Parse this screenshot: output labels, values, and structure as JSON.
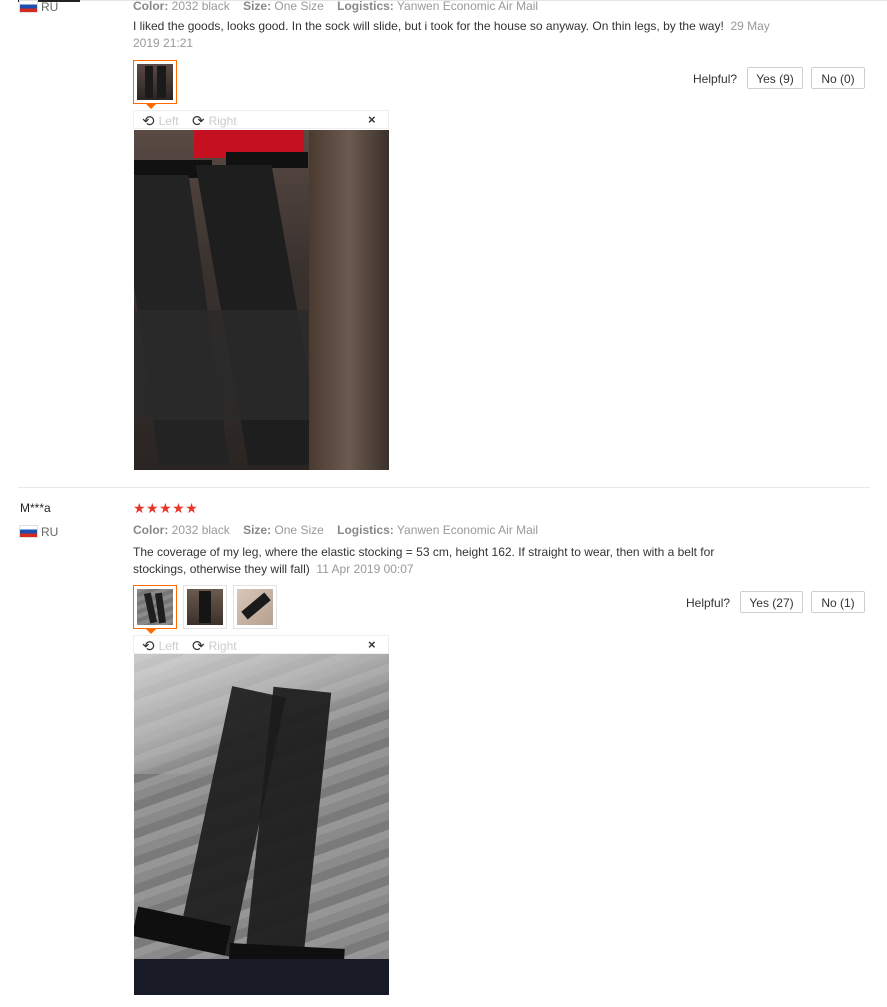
{
  "reviews": [
    {
      "country": "RU",
      "meta": {
        "color_label": "Color:",
        "color_value": "2032 black",
        "size_label": "Size:",
        "size_value": "One Size",
        "logistics_label": "Logistics:",
        "logistics_value": "Yanwen Economic Air Mail"
      },
      "text": "I liked the goods, looks good. In the sock will slide, but i took for the house so anyway. On thin legs, by the way!",
      "date": "29 May 2019 21:21",
      "helpful_label": "Helpful?",
      "yes_label": "Yes (9)",
      "no_label": "No (0)",
      "rotate_left": "Left",
      "rotate_right": "Right",
      "close": "×"
    },
    {
      "user": "M***a",
      "country": "RU",
      "stars": "★★★★★",
      "rating": 5,
      "meta": {
        "color_label": "Color:",
        "color_value": "2032 black",
        "size_label": "Size:",
        "size_value": "One Size",
        "logistics_label": "Logistics:",
        "logistics_value": "Yanwen Economic Air Mail"
      },
      "text": "The coverage of my leg, where the elastic stocking = 53 cm, height 162. If straight to wear, then with a belt for stockings, otherwise they will fall)",
      "date": "11 Apr 2019 00:07",
      "helpful_label": "Helpful?",
      "yes_label": "Yes (27)",
      "no_label": "No (1)",
      "rotate_left": "Left",
      "rotate_right": "Right",
      "close": "×"
    }
  ],
  "colors": {
    "accent": "#ff6a00",
    "star": "#e8372a"
  }
}
